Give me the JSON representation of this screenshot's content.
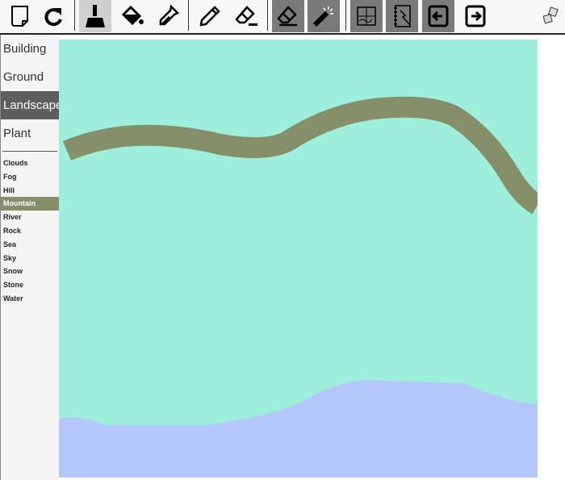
{
  "toolbar": {
    "tools": [
      {
        "name": "new-page",
        "state": "normal"
      },
      {
        "name": "redo",
        "state": "normal"
      },
      {
        "name": "brush",
        "state": "active"
      },
      {
        "name": "paint-bucket",
        "state": "normal"
      },
      {
        "name": "eyedropper",
        "state": "normal"
      },
      {
        "name": "pencil",
        "state": "normal"
      },
      {
        "name": "line-eraser",
        "state": "normal"
      },
      {
        "name": "eraser",
        "state": "dark"
      },
      {
        "name": "magic-wand",
        "state": "dark"
      },
      {
        "name": "map",
        "state": "dark"
      },
      {
        "name": "notebook",
        "state": "dark"
      },
      {
        "name": "arrow-left",
        "state": "dark"
      },
      {
        "name": "arrow-right",
        "state": "normal"
      },
      {
        "name": "dice",
        "state": "normal"
      }
    ]
  },
  "sidebar": {
    "categories": [
      "Building",
      "Ground",
      "Landscape",
      "Plant"
    ],
    "selected_category": "Landscape",
    "items": [
      "Clouds",
      "Fog",
      "Hill",
      "Mountain",
      "River",
      "Rock",
      "Sea",
      "Sky",
      "Snow",
      "Stone",
      "Water"
    ],
    "selected_item": "Mountain"
  },
  "colors": {
    "canvas": "#9eeedc",
    "mountain": "#85906a",
    "water": "#b3c7fb",
    "active_tool": "#cfcfcf",
    "dark_tool": "#7a7a7a"
  }
}
